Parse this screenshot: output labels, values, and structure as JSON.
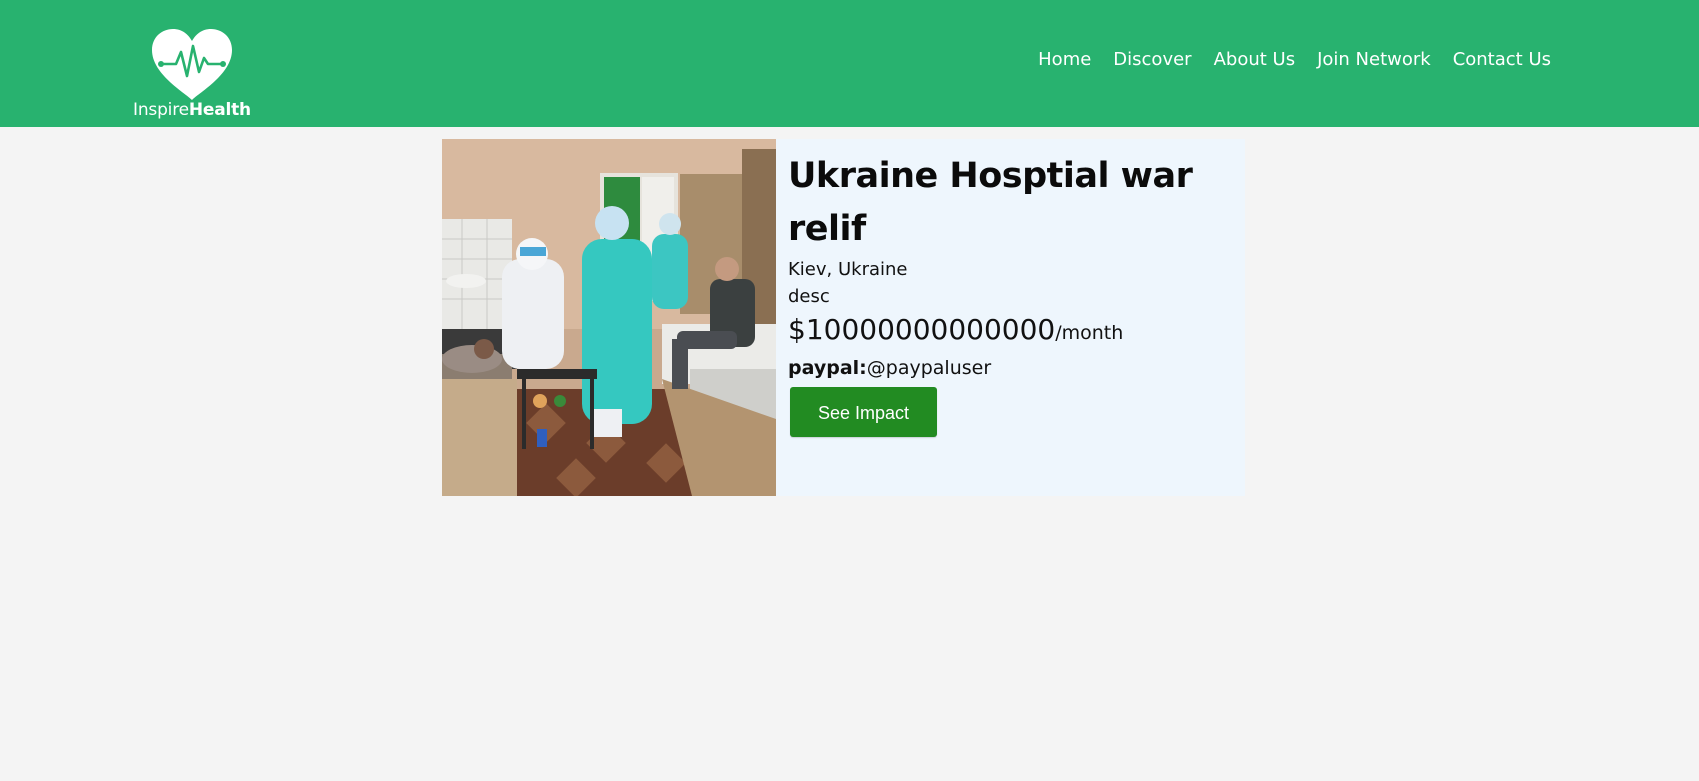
{
  "brand": {
    "name_light": "Inspire",
    "name_bold": "Health",
    "accent_color": "#28b26f",
    "icon": "heart-pulse-icon"
  },
  "nav": {
    "items": [
      "Home",
      "Discover",
      "About Us",
      "Join Network",
      "Contact Us"
    ]
  },
  "campaign": {
    "image_icon": "hospital-photo",
    "title": "Ukraine Hosptial war relif",
    "location": "Kiev, Ukraine",
    "description": "desc",
    "amount": "$10000000000000",
    "period": "/month",
    "paypal_label": "paypal:",
    "paypal_handle": "@paypaluser",
    "button_label": "See Impact",
    "button_color": "#228b22"
  }
}
